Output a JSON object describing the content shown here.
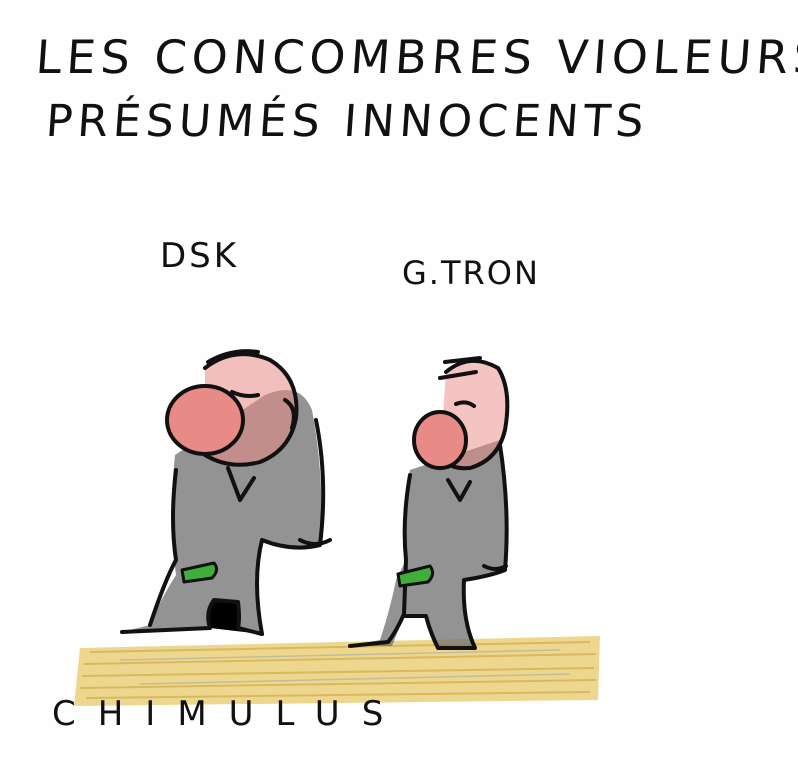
{
  "caption": {
    "line1": "Les concombres violeurs",
    "line2": "présumés innocents"
  },
  "figures": [
    {
      "label": "DSK"
    },
    {
      "label": "G.TRON"
    }
  ],
  "signature": "CHIMULUS",
  "colors": {
    "ink": "#111111",
    "skin": "#e88a86",
    "suit": "#6f6f6f",
    "cucumber": "#3fae3a",
    "ground": "#e2c25a"
  }
}
